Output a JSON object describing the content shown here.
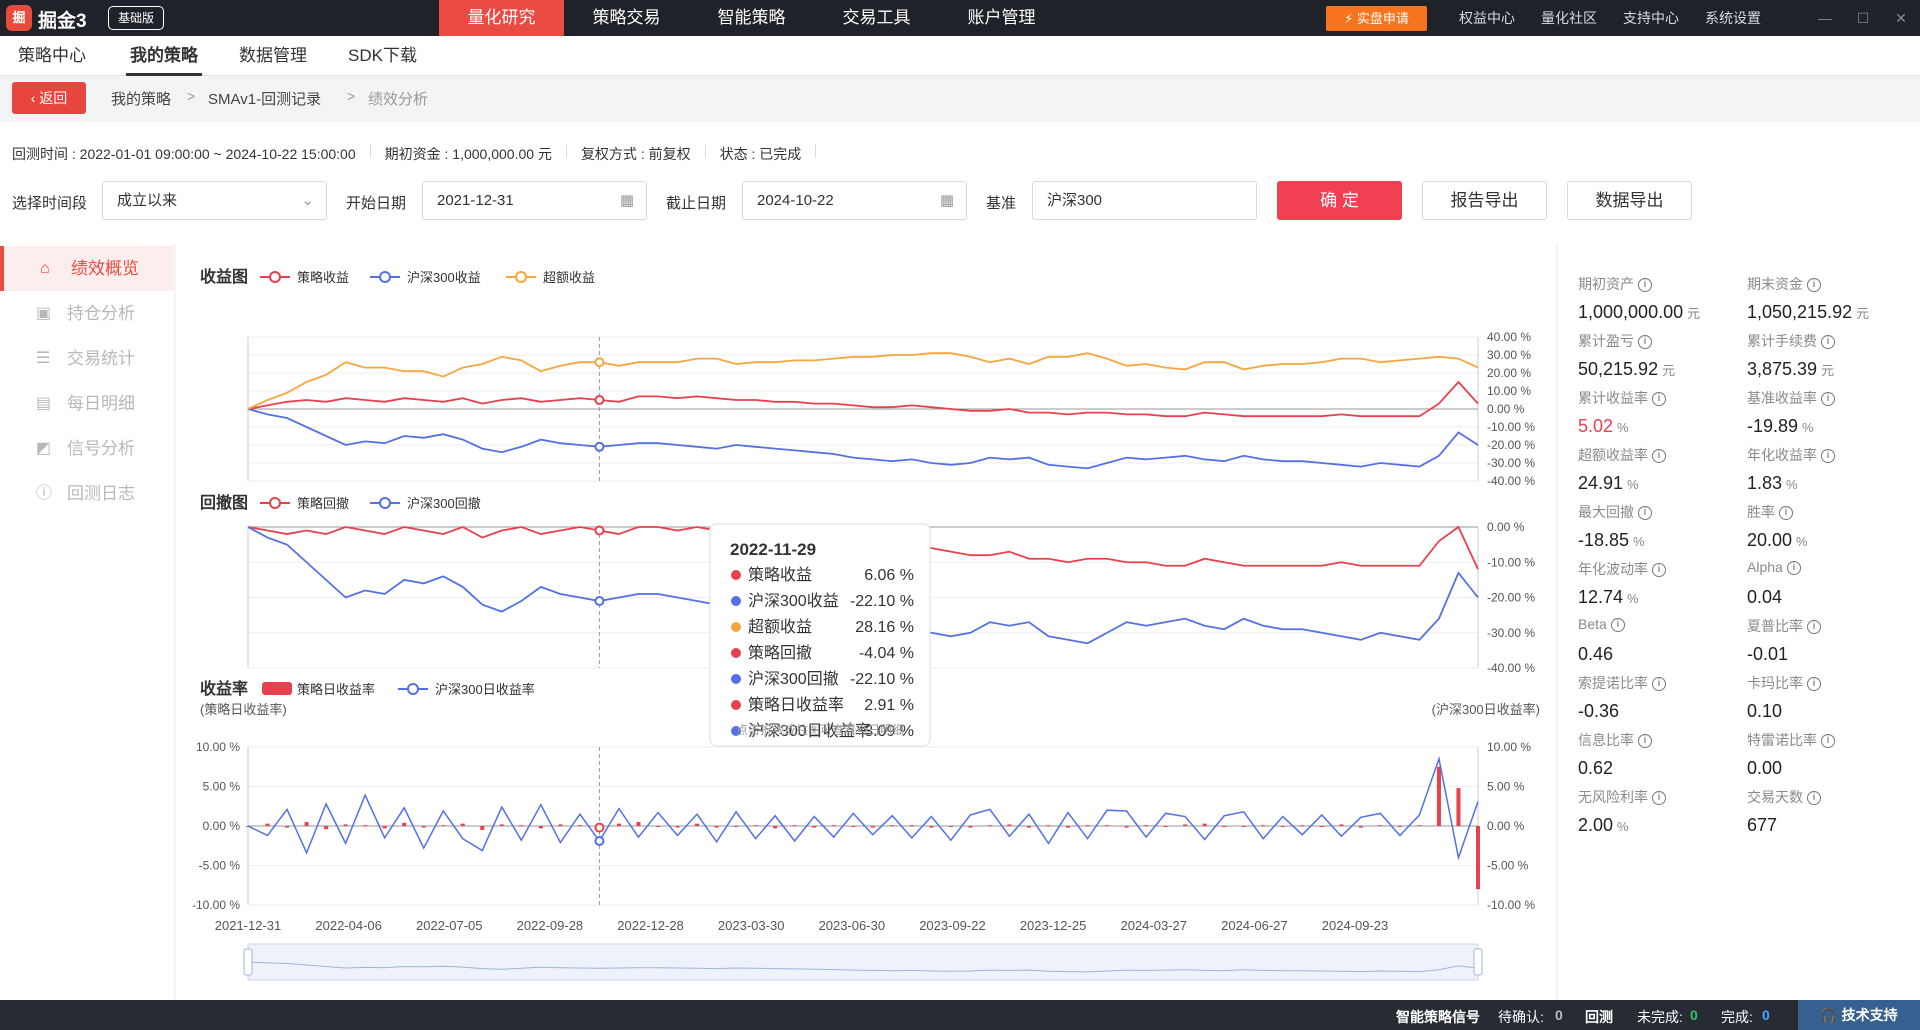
{
  "app": {
    "logo": "掘",
    "name": "掘金3",
    "edition": "基础版"
  },
  "topnav": [
    "量化研究",
    "策略交易",
    "智能策略",
    "交易工具",
    "账户管理"
  ],
  "live_button": "⚡ 实盘申请",
  "toplinks": [
    "权益中心",
    "量化社区",
    "支持中心",
    "系统设置"
  ],
  "subtabs": [
    "策略中心",
    "我的策略",
    "数据管理",
    "SDK下载"
  ],
  "breadcrumb": {
    "back": "返回",
    "items": [
      "我的策略",
      "SMAv1-回测记录",
      "绩效分析"
    ]
  },
  "info": {
    "period": "回测时间 : 2022-01-01 09:00:00 ~ 2024-10-22 15:00:00",
    "capital": "期初资金 : 1,000,000.00 元",
    "adjust": "复权方式 : 前复权",
    "status": "状态 : 已完成"
  },
  "form": {
    "range_label": "选择时间段",
    "range_value": "成立以来",
    "start_label": "开始日期",
    "start_value": "2021-12-31",
    "end_label": "截止日期",
    "end_value": "2024-10-22",
    "bench_label": "基准",
    "bench_value": "沪深300",
    "confirm": "确 定",
    "export_report": "报告导出",
    "export_data": "数据导出"
  },
  "sidebar": [
    "绩效概览",
    "持仓分析",
    "交易统计",
    "每日明细",
    "信号分析",
    "回测日志"
  ],
  "chart_data": [
    {
      "type": "line",
      "title": "收益图",
      "series": [
        {
          "name": "策略收益",
          "color": "#e8404d",
          "values": [
            0,
            2,
            4,
            5,
            4,
            6,
            5,
            4,
            6,
            5,
            4,
            6,
            3,
            5,
            6,
            4,
            5,
            6,
            5,
            4,
            7,
            7,
            6,
            7,
            6,
            5,
            5,
            4,
            4,
            3,
            3,
            2,
            1,
            1,
            2,
            1,
            0,
            -1,
            -1,
            0,
            -2,
            -2,
            -3,
            -2,
            -2,
            -3,
            -3,
            -4,
            -4,
            -2,
            -3,
            -4,
            -4,
            -4,
            -4,
            -4,
            -3,
            -4,
            -4,
            -4,
            -4,
            3,
            15,
            3
          ]
        },
        {
          "name": "沪深300收益",
          "color": "#5470e6",
          "values": [
            0,
            -3,
            -5,
            -10,
            -15,
            -20,
            -18,
            -19,
            -15,
            -16,
            -14,
            -17,
            -22,
            -24,
            -21,
            -17,
            -19,
            -20,
            -21,
            -20,
            -19,
            -19,
            -20,
            -21,
            -22,
            -20,
            -21,
            -22,
            -23,
            -24,
            -25,
            -27,
            -28,
            -29,
            -28,
            -30,
            -31,
            -30,
            -27,
            -28,
            -27,
            -31,
            -32,
            -33,
            -30,
            -27,
            -28,
            -27,
            -26,
            -28,
            -29,
            -26,
            -28,
            -29,
            -29,
            -30,
            -31,
            -32,
            -30,
            -31,
            -32,
            -26,
            -13,
            -20
          ]
        },
        {
          "name": "超额收益",
          "color": "#f5a63f",
          "values": [
            0,
            5,
            9,
            15,
            19,
            26,
            23,
            23,
            21,
            21,
            18,
            23,
            25,
            29,
            27,
            21,
            24,
            26,
            26,
            24,
            26,
            26,
            26,
            28,
            28,
            25,
            26,
            26,
            27,
            27,
            28,
            29,
            29,
            30,
            30,
            31,
            31,
            29,
            26,
            28,
            25,
            29,
            29,
            31,
            28,
            24,
            25,
            23,
            22,
            26,
            26,
            22,
            24,
            25,
            25,
            26,
            28,
            28,
            26,
            27,
            28,
            29,
            28,
            23
          ]
        }
      ],
      "ylim": [
        -40,
        40
      ],
      "yticks": [
        "40.00 %",
        "30.00 %",
        "20.00 %",
        "10.00 %",
        "0.00 %",
        "-10.00 %",
        "-20.00 %",
        "-30.00 %",
        "-40.00 %"
      ]
    },
    {
      "type": "line",
      "title": "回撤图",
      "series": [
        {
          "name": "策略回撤",
          "color": "#e8404d",
          "values": [
            0,
            -1,
            -2,
            -1,
            -2,
            0,
            -1,
            -2,
            0,
            -1,
            -2,
            0,
            -3,
            -1,
            0,
            -2,
            -1,
            0,
            -1,
            -2,
            0,
            0,
            -1,
            0,
            -1,
            -2,
            -2,
            -3,
            -3,
            -4,
            -4,
            -5,
            -6,
            -6,
            -5,
            -6,
            -7,
            -8,
            -8,
            -7,
            -9,
            -9,
            -10,
            -9,
            -9,
            -10,
            -10,
            -11,
            -11,
            -9,
            -10,
            -11,
            -11,
            -11,
            -11,
            -11,
            -10,
            -11,
            -11,
            -11,
            -11,
            -4,
            0,
            -12
          ]
        },
        {
          "name": "沪深300回撤",
          "color": "#5470e6",
          "values": [
            0,
            -3,
            -5,
            -10,
            -15,
            -20,
            -18,
            -19,
            -15,
            -16,
            -14,
            -17,
            -22,
            -24,
            -21,
            -17,
            -19,
            -20,
            -21,
            -20,
            -19,
            -19,
            -20,
            -21,
            -22,
            -20,
            -21,
            -22,
            -23,
            -24,
            -25,
            -27,
            -28,
            -29,
            -28,
            -30,
            -31,
            -30,
            -27,
            -28,
            -27,
            -31,
            -32,
            -33,
            -30,
            -27,
            -28,
            -27,
            -26,
            -28,
            -29,
            -26,
            -28,
            -29,
            -29,
            -30,
            -31,
            -32,
            -30,
            -31,
            -32,
            -26,
            -13,
            -20
          ]
        }
      ],
      "ylim": [
        -40,
        0
      ],
      "yticks": [
        "0.00 %",
        "-10.00 %",
        "-20.00 %",
        "-30.00 %",
        "-40.00 %"
      ]
    },
    {
      "type": "bar",
      "title": "收益率",
      "left_axis_label": "(策略日收益率)",
      "right_axis_label": "(沪深300日收益率)",
      "series": [
        {
          "name": "策略日收益率",
          "color": "#e8404d",
          "values": [
            0,
            0.3,
            -0.2,
            0.5,
            -0.4,
            0.2,
            0.1,
            -0.3,
            0.4,
            -0.2,
            0.1,
            0.3,
            -0.5,
            0.2,
            0.1,
            -0.3,
            0.2,
            0.1,
            -0.2,
            0.3,
            0.5,
            -0.1,
            -0.2,
            0.3,
            -0.2,
            -0.1,
            0.1,
            -0.3,
            0.1,
            -0.2,
            0.1,
            -0.1,
            -0.2,
            0.1,
            0.1,
            -0.2,
            -0.1,
            -0.2,
            0.1,
            0.2,
            -0.2,
            0.1,
            -0.2,
            0.1,
            0.1,
            -0.2,
            0.1,
            -0.1,
            0.2,
            0.3,
            -0.1,
            -0.1,
            0.1,
            -0.1,
            0.1,
            -0.1,
            0.2,
            -0.2,
            0.1,
            -0.1,
            0.1,
            7.5,
            4.8,
            -8.0
          ]
        },
        {
          "name": "沪深300日收益率",
          "color": "#5470e6",
          "values": [
            0,
            -1.2,
            2.1,
            -3.4,
            2.8,
            -2.2,
            3.9,
            -1.5,
            2.3,
            -2.8,
            1.9,
            -1.6,
            -3.1,
            2.4,
            -1.8,
            2.7,
            -2.1,
            1.5,
            -1.9,
            2.2,
            -1.4,
            1.7,
            -1.2,
            1.5,
            -2.0,
            1.8,
            -1.6,
            1.3,
            -1.9,
            1.2,
            -1.4,
            1.6,
            -1.1,
            1.3,
            -1.5,
            1.2,
            -1.8,
            1.4,
            2.1,
            -1.3,
            1.5,
            -2.2,
            1.7,
            -1.6,
            2.0,
            1.9,
            -1.4,
            1.6,
            1.2,
            -1.7,
            1.3,
            1.8,
            -1.6,
            1.2,
            -1.1,
            1.4,
            -1.3,
            1.1,
            1.6,
            -1.2,
            1.4,
            8.5,
            -4.0,
            3.1
          ]
        }
      ],
      "ylim": [
        -10,
        10
      ],
      "yticks": [
        "10.00 %",
        "5.00 %",
        "0.00 %",
        "-5.00 %",
        "-10.00 %"
      ]
    }
  ],
  "xaxis_labels": [
    "2021-12-31",
    "2022-04-06",
    "2022-07-05",
    "2022-09-28",
    "2022-12-28",
    "2023-03-30",
    "2023-06-30",
    "2023-09-22",
    "2023-12-25",
    "2024-03-27",
    "2024-06-27",
    "2024-09-23"
  ],
  "hover_index": 18,
  "tooltip": {
    "date": "2022-11-29",
    "rows": [
      {
        "name": "策略收益",
        "value": "6.06 %",
        "color": "#e8404d"
      },
      {
        "name": "沪深300收益",
        "value": "-22.10 %",
        "color": "#5470e6"
      },
      {
        "name": "超额收益",
        "value": "28.16 %",
        "color": "#f5a63f"
      },
      {
        "name": "策略回撤",
        "value": "-4.04 %",
        "color": "#e8404d"
      },
      {
        "name": "沪深300回撤",
        "value": "-22.10 %",
        "color": "#5470e6"
      },
      {
        "name": "策略日收益率",
        "value": "2.91 %",
        "color": "#e8404d"
      },
      {
        "name": "沪深300日收益率",
        "value": "3.09 %",
        "color": "#5470e6"
      }
    ],
    "hint": "点击折线或柱图可查看当日明细"
  },
  "metrics": [
    {
      "label": "期初资产",
      "value": "1,000,000.00",
      "unit": "元"
    },
    {
      "label": "期末资金",
      "value": "1,050,215.92",
      "unit": "元"
    },
    {
      "label": "累计盈亏",
      "value": "50,215.92",
      "unit": "元"
    },
    {
      "label": "累计手续费",
      "value": "3,875.39",
      "unit": "元"
    },
    {
      "label": "累计收益率",
      "value": "5.02",
      "unit": "%",
      "color": "#e8404d"
    },
    {
      "label": "基准收益率",
      "value": "-19.89",
      "unit": "%"
    },
    {
      "label": "超额收益率",
      "value": "24.91",
      "unit": "%"
    },
    {
      "label": "年化收益率",
      "value": "1.83",
      "unit": "%"
    },
    {
      "label": "最大回撤",
      "value": "-18.85",
      "unit": "%"
    },
    {
      "label": "胜率",
      "value": "20.00",
      "unit": "%"
    },
    {
      "label": "年化波动率",
      "value": "12.74",
      "unit": "%"
    },
    {
      "label": "Alpha",
      "value": "0.04",
      "unit": ""
    },
    {
      "label": "Beta",
      "value": "0.46",
      "unit": ""
    },
    {
      "label": "夏普比率",
      "value": "-0.01",
      "unit": ""
    },
    {
      "label": "索提诺比率",
      "value": "-0.36",
      "unit": ""
    },
    {
      "label": "卡玛比率",
      "value": "0.10",
      "unit": ""
    },
    {
      "label": "信息比率",
      "value": "0.62",
      "unit": ""
    },
    {
      "label": "特雷诺比率",
      "value": "0.00",
      "unit": ""
    },
    {
      "label": "无风险利率",
      "value": "2.00",
      "unit": "%"
    },
    {
      "label": "交易天数",
      "value": "677",
      "unit": ""
    }
  ],
  "statusbar": {
    "signal": "智能策略信号",
    "pending_label": "待确认:",
    "pending": "0",
    "backtest": "回测",
    "unfinished_label": "未完成:",
    "unfinished": "0",
    "finished_label": "完成:",
    "finished": "0",
    "support": "🎧 技术支持"
  }
}
